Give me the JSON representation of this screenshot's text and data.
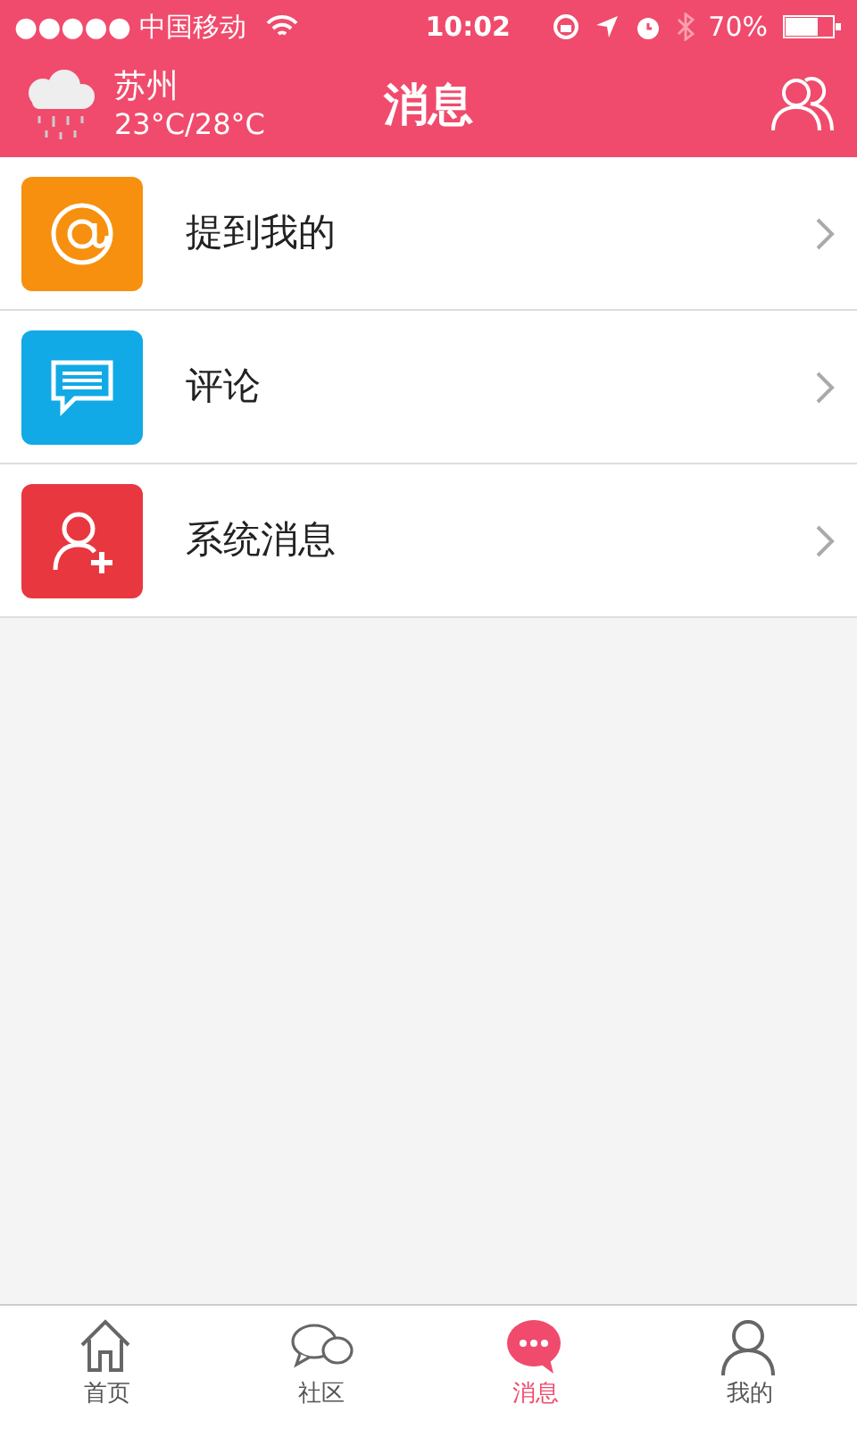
{
  "status_bar": {
    "carrier": "●●●●● 中国移动",
    "time": "10:02",
    "battery": "70%"
  },
  "header": {
    "city": "苏州",
    "temperature": "23°C/28°C",
    "title": "消息"
  },
  "items": [
    {
      "kind": "mention",
      "label": "提到我的",
      "color": "#f7900e"
    },
    {
      "kind": "comment",
      "label": "评论",
      "color": "#11a9e6"
    },
    {
      "kind": "system",
      "label": "系统消息",
      "color": "#e8373f"
    }
  ],
  "tabs": [
    {
      "kind": "home",
      "label": "首页",
      "selected": false
    },
    {
      "kind": "community",
      "label": "社区",
      "selected": false
    },
    {
      "kind": "messages",
      "label": "消息",
      "selected": true
    },
    {
      "kind": "profile",
      "label": "我的",
      "selected": false
    }
  ]
}
